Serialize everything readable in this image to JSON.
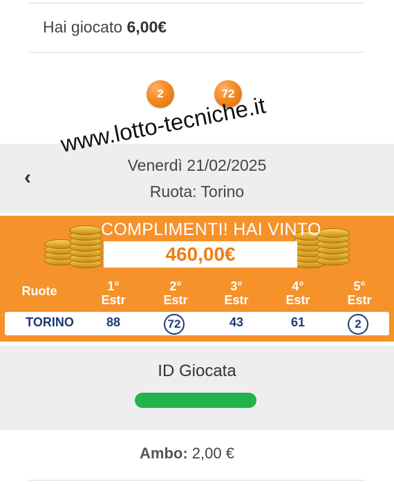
{
  "played": {
    "label": "Hai giocato",
    "amount": "6,00€"
  },
  "played_numbers": [
    "2",
    "72"
  ],
  "watermark": "www.lotto-tecniche.it",
  "draw": {
    "date": "Venerdì 21/02/2025",
    "ruota": "Ruota: Torino"
  },
  "win": {
    "message": "COMPLIMENTI! HAI VINTO",
    "amount": "460,00€"
  },
  "table": {
    "headers": [
      "Ruote",
      "1°\nEstr",
      "2°\nEstr",
      "3°\nEstr",
      "4°\nEstr",
      "5°\nEstr"
    ],
    "row": {
      "ruota": "TORINO",
      "values": [
        "88",
        "72",
        "43",
        "61",
        "2"
      ],
      "matched": [
        false,
        true,
        false,
        false,
        true
      ]
    }
  },
  "id": {
    "label": "ID Giocata"
  },
  "ambo": {
    "label": "Ambo:",
    "amount": "2,00 €"
  },
  "colors": {
    "orange": "#f5922a",
    "navy": "#1b3b73",
    "mask": "#22b34a"
  }
}
